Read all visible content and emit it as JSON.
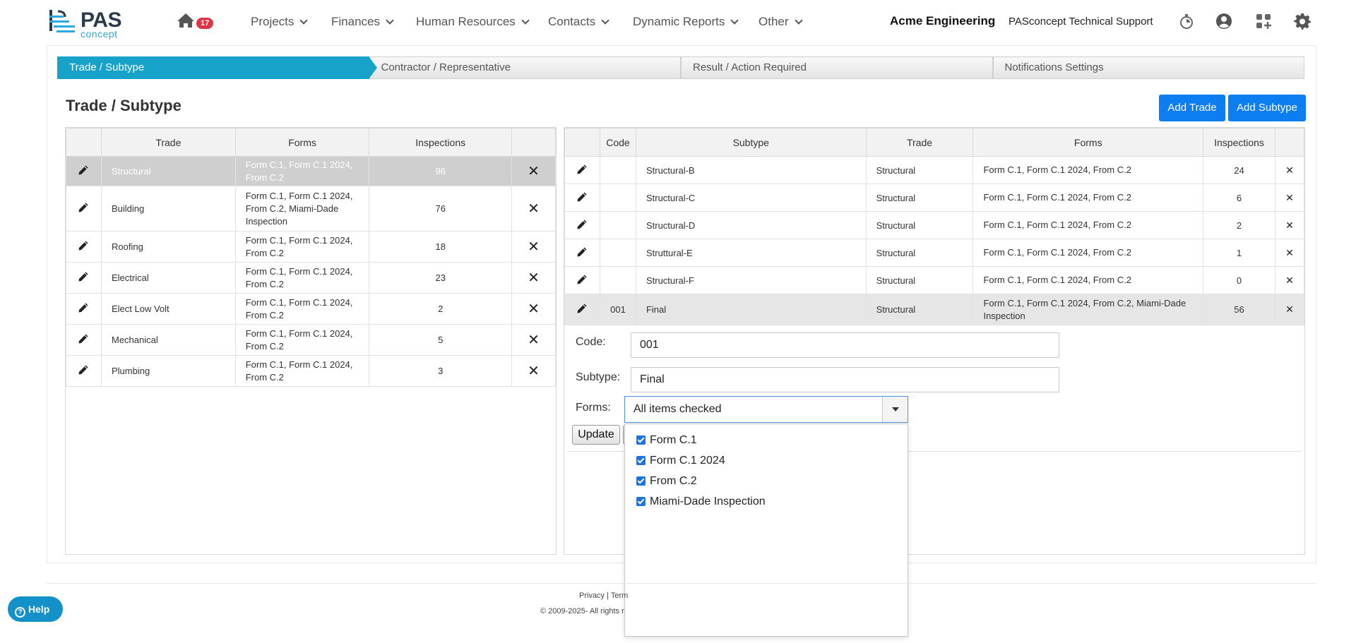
{
  "header": {
    "logo_main": "PAS",
    "logo_sub": "concept",
    "notification_count": "17",
    "nav": [
      "Projects",
      "Finances",
      "Human Resources",
      "Contacts",
      "Dynamic Reports",
      "Other"
    ],
    "company": "Acme Engineering",
    "support": "PASconcept Technical Support"
  },
  "steps": [
    "Trade / Subtype",
    "Contractor / Representative",
    "Result / Action Required",
    "Notifications Settings"
  ],
  "page_title": "Trade / Subtype",
  "buttons": {
    "add_trade": "Add Trade",
    "add_subtype": "Add Subtype",
    "update": "Update"
  },
  "trades": {
    "headers": [
      "Trade",
      "Forms",
      "Inspections"
    ],
    "rows": [
      {
        "trade": "Structural",
        "forms": "Form C.1, Form C.1 2024, From C.2",
        "inspections": "96"
      },
      {
        "trade": "Building",
        "forms": "Form C.1, Form C.1 2024, From C.2, Miami-Dade Inspection",
        "inspections": "76"
      },
      {
        "trade": "Roofing",
        "forms": "Form C.1, Form C.1 2024, From C.2",
        "inspections": "18"
      },
      {
        "trade": "Electrical",
        "forms": "Form C.1, Form C.1 2024, From C.2",
        "inspections": "23"
      },
      {
        "trade": "Elect Low Volt",
        "forms": "Form C.1, Form C.1 2024, From C.2",
        "inspections": "2"
      },
      {
        "trade": "Mechanical",
        "forms": "Form C.1, Form C.1 2024, From C.2",
        "inspections": "5"
      },
      {
        "trade": "Plumbing",
        "forms": "Form C.1, Form C.1 2024, From C.2",
        "inspections": "3"
      }
    ]
  },
  "subtypes": {
    "headers": [
      "Code",
      "Subtype",
      "Trade",
      "Forms",
      "Inspections"
    ],
    "rows": [
      {
        "code": "",
        "subtype": "Structural-B",
        "trade": "Structural",
        "forms": "Form C.1, Form C.1 2024, From C.2",
        "inspections": "24"
      },
      {
        "code": "",
        "subtype": "Structural-C",
        "trade": "Structural",
        "forms": "Form C.1, Form C.1 2024, From C.2",
        "inspections": "6"
      },
      {
        "code": "",
        "subtype": "Structural-D",
        "trade": "Structural",
        "forms": "Form C.1, Form C.1 2024, From C.2",
        "inspections": "2"
      },
      {
        "code": "",
        "subtype": "Struttural-E",
        "trade": "Structural",
        "forms": "Form C.1, Form C.1 2024, From C.2",
        "inspections": "1"
      },
      {
        "code": "",
        "subtype": "Structural-F",
        "trade": "Structural",
        "forms": "Form C.1, Form C.1 2024, From C.2",
        "inspections": "0"
      },
      {
        "code": "001",
        "subtype": "Final",
        "trade": "Structural",
        "forms": "Form C.1, Form C.1 2024, From C.2, Miami-Dade Inspection",
        "inspections": "56"
      }
    ]
  },
  "form": {
    "code_label": "Code:",
    "code_value": "001",
    "subtype_label": "Subtype:",
    "subtype_value": "Final",
    "forms_label": "Forms:",
    "forms_value": "All items checked",
    "options": [
      "Form C.1",
      "Form C.1 2024",
      "From C.2",
      "Miami-Dade Inspection"
    ]
  },
  "footer": {
    "links": "Privacy | Term",
    "copyright": "© 2009-2025- All rights r",
    "help": "Help"
  },
  "colors": {
    "accent": "#17a2c9",
    "primary": "#0d7ef2",
    "badge": "#dc3545"
  }
}
